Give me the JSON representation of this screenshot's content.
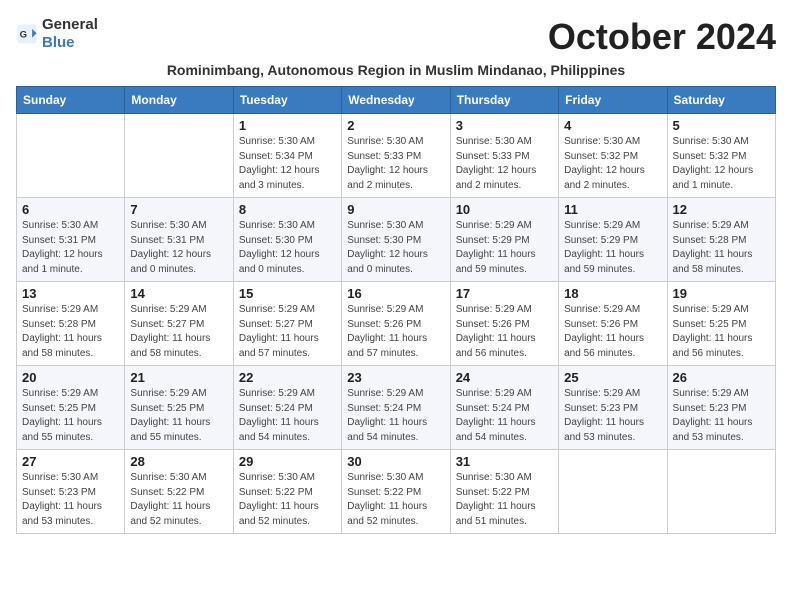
{
  "header": {
    "logo_general": "General",
    "logo_blue": "Blue",
    "month_title": "October 2024",
    "subtitle": "Rominimbang, Autonomous Region in Muslim Mindanao, Philippines"
  },
  "weekdays": [
    "Sunday",
    "Monday",
    "Tuesday",
    "Wednesday",
    "Thursday",
    "Friday",
    "Saturday"
  ],
  "rows": [
    [
      {
        "day": "",
        "info": ""
      },
      {
        "day": "",
        "info": ""
      },
      {
        "day": "1",
        "info": "Sunrise: 5:30 AM\nSunset: 5:34 PM\nDaylight: 12 hours and 3 minutes."
      },
      {
        "day": "2",
        "info": "Sunrise: 5:30 AM\nSunset: 5:33 PM\nDaylight: 12 hours and 2 minutes."
      },
      {
        "day": "3",
        "info": "Sunrise: 5:30 AM\nSunset: 5:33 PM\nDaylight: 12 hours and 2 minutes."
      },
      {
        "day": "4",
        "info": "Sunrise: 5:30 AM\nSunset: 5:32 PM\nDaylight: 12 hours and 2 minutes."
      },
      {
        "day": "5",
        "info": "Sunrise: 5:30 AM\nSunset: 5:32 PM\nDaylight: 12 hours and 1 minute."
      }
    ],
    [
      {
        "day": "6",
        "info": "Sunrise: 5:30 AM\nSunset: 5:31 PM\nDaylight: 12 hours and 1 minute."
      },
      {
        "day": "7",
        "info": "Sunrise: 5:30 AM\nSunset: 5:31 PM\nDaylight: 12 hours and 0 minutes."
      },
      {
        "day": "8",
        "info": "Sunrise: 5:30 AM\nSunset: 5:30 PM\nDaylight: 12 hours and 0 minutes."
      },
      {
        "day": "9",
        "info": "Sunrise: 5:30 AM\nSunset: 5:30 PM\nDaylight: 12 hours and 0 minutes."
      },
      {
        "day": "10",
        "info": "Sunrise: 5:29 AM\nSunset: 5:29 PM\nDaylight: 11 hours and 59 minutes."
      },
      {
        "day": "11",
        "info": "Sunrise: 5:29 AM\nSunset: 5:29 PM\nDaylight: 11 hours and 59 minutes."
      },
      {
        "day": "12",
        "info": "Sunrise: 5:29 AM\nSunset: 5:28 PM\nDaylight: 11 hours and 58 minutes."
      }
    ],
    [
      {
        "day": "13",
        "info": "Sunrise: 5:29 AM\nSunset: 5:28 PM\nDaylight: 11 hours and 58 minutes."
      },
      {
        "day": "14",
        "info": "Sunrise: 5:29 AM\nSunset: 5:27 PM\nDaylight: 11 hours and 58 minutes."
      },
      {
        "day": "15",
        "info": "Sunrise: 5:29 AM\nSunset: 5:27 PM\nDaylight: 11 hours and 57 minutes."
      },
      {
        "day": "16",
        "info": "Sunrise: 5:29 AM\nSunset: 5:26 PM\nDaylight: 11 hours and 57 minutes."
      },
      {
        "day": "17",
        "info": "Sunrise: 5:29 AM\nSunset: 5:26 PM\nDaylight: 11 hours and 56 minutes."
      },
      {
        "day": "18",
        "info": "Sunrise: 5:29 AM\nSunset: 5:26 PM\nDaylight: 11 hours and 56 minutes."
      },
      {
        "day": "19",
        "info": "Sunrise: 5:29 AM\nSunset: 5:25 PM\nDaylight: 11 hours and 56 minutes."
      }
    ],
    [
      {
        "day": "20",
        "info": "Sunrise: 5:29 AM\nSunset: 5:25 PM\nDaylight: 11 hours and 55 minutes."
      },
      {
        "day": "21",
        "info": "Sunrise: 5:29 AM\nSunset: 5:25 PM\nDaylight: 11 hours and 55 minutes."
      },
      {
        "day": "22",
        "info": "Sunrise: 5:29 AM\nSunset: 5:24 PM\nDaylight: 11 hours and 54 minutes."
      },
      {
        "day": "23",
        "info": "Sunrise: 5:29 AM\nSunset: 5:24 PM\nDaylight: 11 hours and 54 minutes."
      },
      {
        "day": "24",
        "info": "Sunrise: 5:29 AM\nSunset: 5:24 PM\nDaylight: 11 hours and 54 minutes."
      },
      {
        "day": "25",
        "info": "Sunrise: 5:29 AM\nSunset: 5:23 PM\nDaylight: 11 hours and 53 minutes."
      },
      {
        "day": "26",
        "info": "Sunrise: 5:29 AM\nSunset: 5:23 PM\nDaylight: 11 hours and 53 minutes."
      }
    ],
    [
      {
        "day": "27",
        "info": "Sunrise: 5:30 AM\nSunset: 5:23 PM\nDaylight: 11 hours and 53 minutes."
      },
      {
        "day": "28",
        "info": "Sunrise: 5:30 AM\nSunset: 5:22 PM\nDaylight: 11 hours and 52 minutes."
      },
      {
        "day": "29",
        "info": "Sunrise: 5:30 AM\nSunset: 5:22 PM\nDaylight: 11 hours and 52 minutes."
      },
      {
        "day": "30",
        "info": "Sunrise: 5:30 AM\nSunset: 5:22 PM\nDaylight: 11 hours and 52 minutes."
      },
      {
        "day": "31",
        "info": "Sunrise: 5:30 AM\nSunset: 5:22 PM\nDaylight: 11 hours and 51 minutes."
      },
      {
        "day": "",
        "info": ""
      },
      {
        "day": "",
        "info": ""
      }
    ]
  ]
}
